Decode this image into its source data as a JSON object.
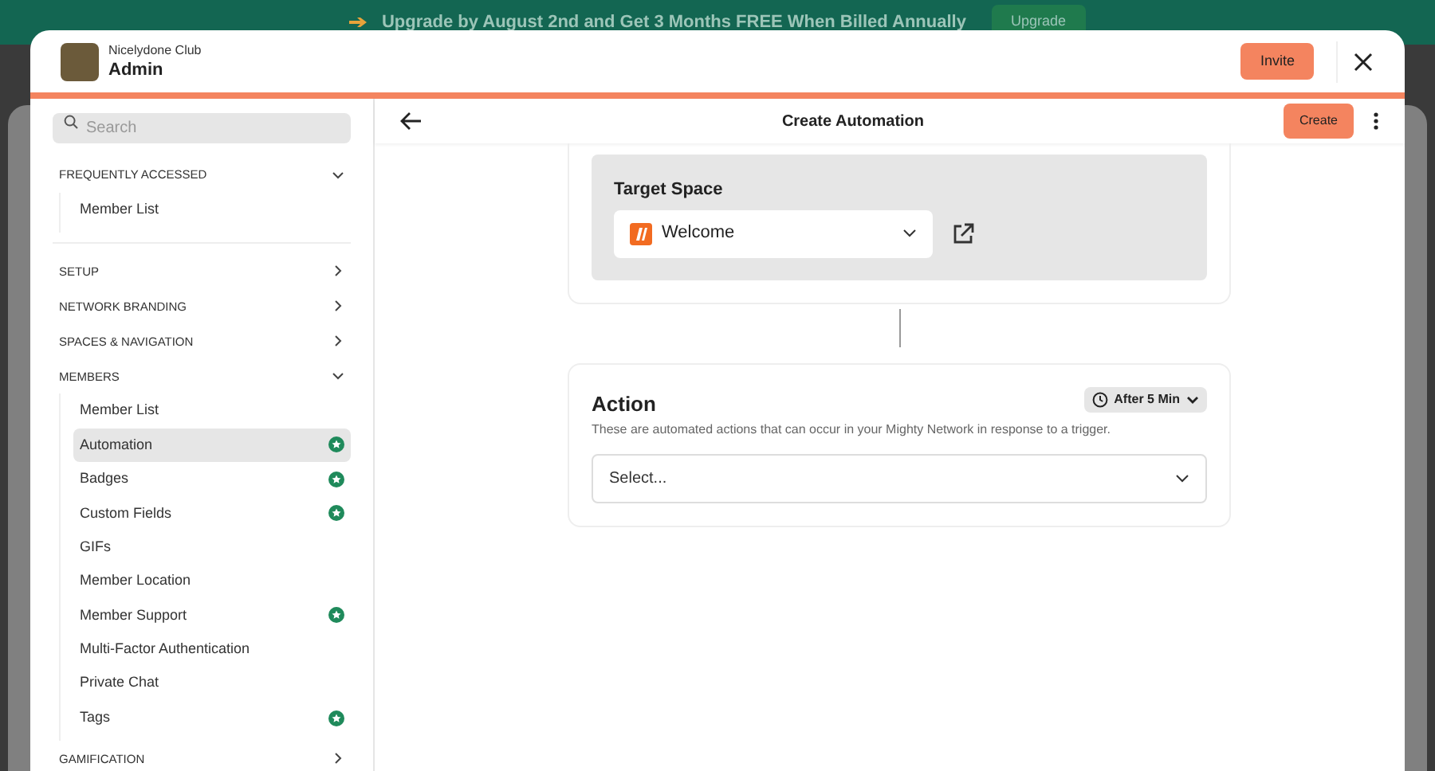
{
  "banner": {
    "text": "Upgrade by August 2nd and Get 3 Months FREE When Billed Annually",
    "button": "Upgrade"
  },
  "header": {
    "org": "Nicelydone Club",
    "title": "Admin",
    "invite_button": "Invite"
  },
  "sidebar": {
    "search": {
      "placeholder": "Search"
    },
    "sections": [
      {
        "label": "FREQUENTLY ACCESSED",
        "expanded": true,
        "items": [
          {
            "label": "Member List",
            "selected": false,
            "premium": false
          }
        ]
      },
      {
        "label": "SETUP",
        "expanded": false
      },
      {
        "label": "NETWORK BRANDING",
        "expanded": false
      },
      {
        "label": "SPACES & NAVIGATION",
        "expanded": false
      },
      {
        "label": "MEMBERS",
        "expanded": true,
        "items": [
          {
            "label": "Member List",
            "selected": false,
            "premium": false
          },
          {
            "label": "Automation",
            "selected": true,
            "premium": true
          },
          {
            "label": "Badges",
            "selected": false,
            "premium": true
          },
          {
            "label": "Custom Fields",
            "selected": false,
            "premium": true
          },
          {
            "label": "GIFs",
            "selected": false,
            "premium": false
          },
          {
            "label": "Member Location",
            "selected": false,
            "premium": false
          },
          {
            "label": "Member Support",
            "selected": false,
            "premium": true
          },
          {
            "label": "Multi-Factor Authentication",
            "selected": false,
            "premium": false
          },
          {
            "label": "Private Chat",
            "selected": false,
            "premium": false
          },
          {
            "label": "Tags",
            "selected": false,
            "premium": true
          }
        ]
      },
      {
        "label": "GAMIFICATION",
        "expanded": false
      }
    ]
  },
  "main": {
    "title": "Create Automation",
    "create_button": "Create",
    "target_space": {
      "label": "Target Space",
      "value": "Welcome"
    },
    "action": {
      "title": "Action",
      "delay": "After 5 Min",
      "description": "These are automated actions that can occur in your Mighty Network in response to a trigger.",
      "placeholder": "Select..."
    }
  }
}
